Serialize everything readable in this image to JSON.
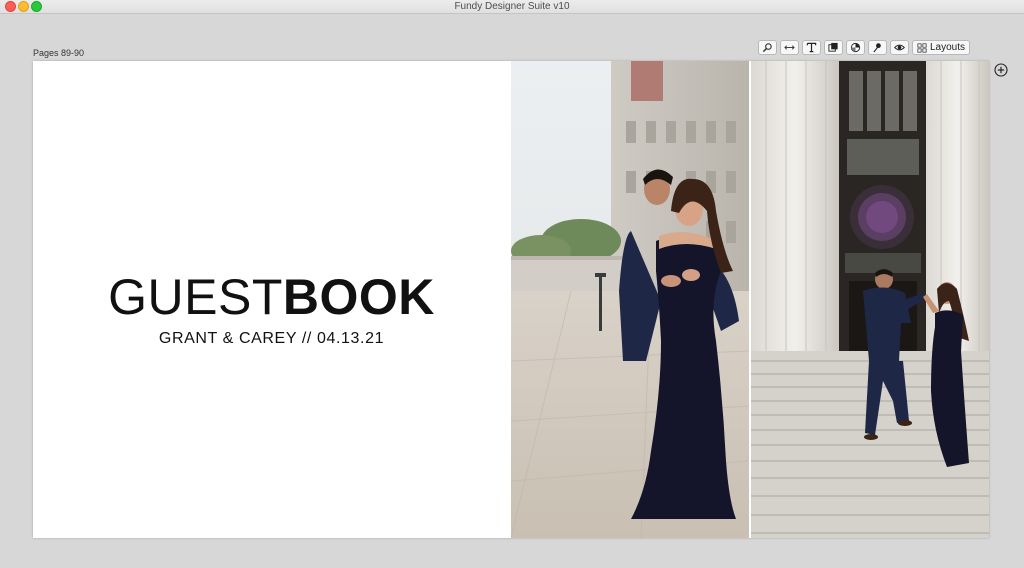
{
  "window": {
    "title": "Fundy Designer Suite v10"
  },
  "spread": {
    "pages_label": "Pages 89-90",
    "headline_light": "GUEST",
    "headline_bold": "BOOK",
    "subline": "GRANT & CAREY // 04.13.21"
  },
  "toolbar": {
    "tools": [
      "zoom-icon",
      "width-arrows-icon",
      "text-icon",
      "layers-icon",
      "color-wheel-icon",
      "pin-icon",
      "eye-icon"
    ],
    "layouts_label": "Layouts"
  },
  "colors": {
    "background": "#d7d7d7",
    "page": "#ffffff",
    "text": "#111111"
  }
}
